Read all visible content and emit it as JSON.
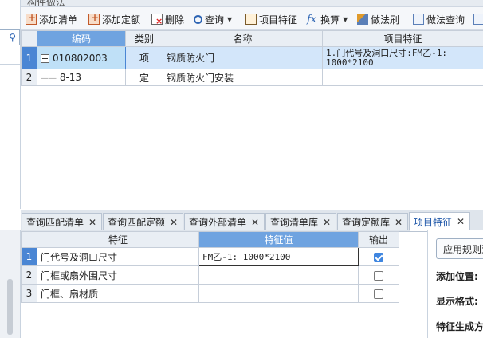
{
  "top_header": "构件做法",
  "toolbar": {
    "add_list": "添加清单",
    "add_quota": "添加定额",
    "delete": "删除",
    "query": "查询",
    "item_feature": "项目特征",
    "convert": "换算",
    "method_brush": "做法刷",
    "method_query": "做法查询"
  },
  "main_table": {
    "headers": {
      "code": "编码",
      "category": "类别",
      "name": "名称",
      "feature": "项目特征"
    },
    "rows": [
      {
        "num": "1",
        "code": "010802003",
        "category": "项",
        "name": "钢质防火门",
        "feature": "1.门代号及洞口尺寸:FM乙-1: 1000*2100"
      },
      {
        "num": "2",
        "code": "8-13",
        "category": "定",
        "name": "钢质防火门安装",
        "feature": ""
      }
    ]
  },
  "tabs": [
    {
      "label": "查询匹配清单"
    },
    {
      "label": "查询匹配定额"
    },
    {
      "label": "查询外部清单"
    },
    {
      "label": "查询清单库"
    },
    {
      "label": "查询定额库"
    },
    {
      "label": "项目特征"
    }
  ],
  "feature_table": {
    "headers": {
      "feature": "特征",
      "value": "特征值",
      "output": "输出"
    },
    "rows": [
      {
        "num": "1",
        "feature": "门代号及洞口尺寸",
        "value": "FM乙-1: 1000*2100",
        "output": true
      },
      {
        "num": "2",
        "feature": "门框或扇外围尺寸",
        "value": "",
        "output": false
      },
      {
        "num": "3",
        "feature": "门框、扇材质",
        "value": "",
        "output": false
      }
    ]
  },
  "right_panel": {
    "apply_button": "应用规则到",
    "add_position": "添加位置:",
    "display_format": "显示格式:",
    "generate_method": "特征生成方"
  }
}
